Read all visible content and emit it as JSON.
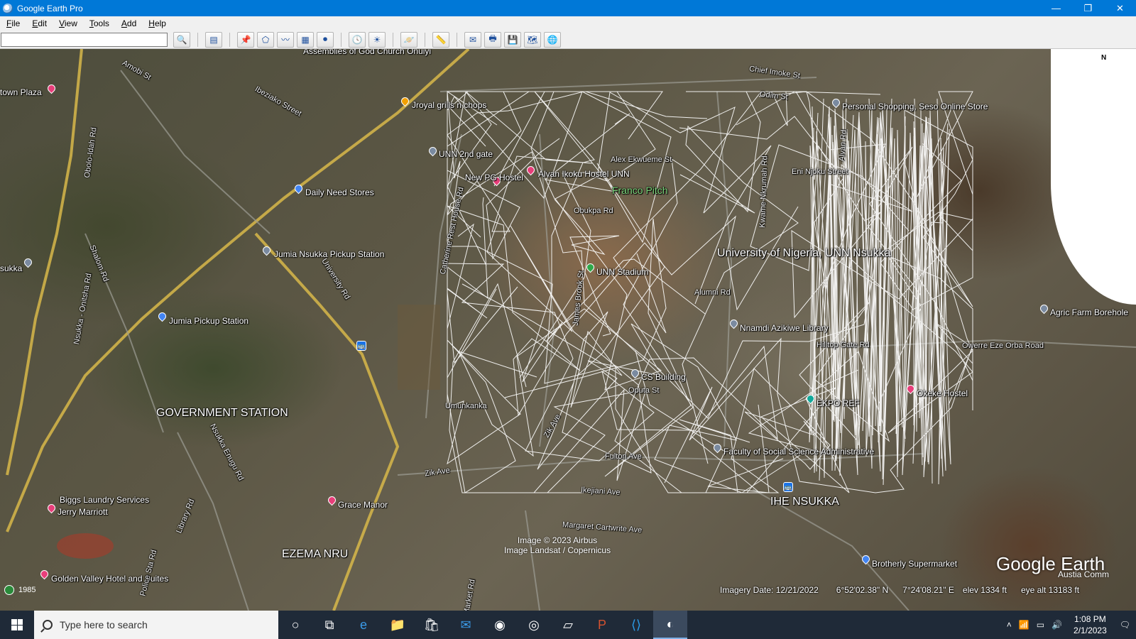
{
  "window": {
    "title": "Google Earth Pro",
    "minimize": "—",
    "restore": "❐",
    "close": "✕"
  },
  "menu": [
    "File",
    "Edit",
    "View",
    "Tools",
    "Add",
    "Help"
  ],
  "toolbar": {
    "search_value": "",
    "search_icon": "search-icon",
    "buttons": [
      "sidebar-toggle-icon",
      "add-placemark-icon",
      "add-polygon-icon",
      "add-path-icon",
      "add-image-overlay-icon",
      "record-tour-icon",
      "historical-imagery-icon",
      "sunlight-icon",
      "switch-planet-icon",
      "ruler-icon",
      "email-icon",
      "print-icon",
      "save-image-icon",
      "view-maps-icon",
      "earth-icon"
    ]
  },
  "map": {
    "north_label": "N",
    "places": [
      {
        "name": "Assemblies of God Church Onuiyi",
        "pin": "none"
      },
      {
        "name": "Chief Imoke St",
        "pin": "none"
      },
      {
        "name": "Odim St",
        "pin": "none"
      },
      {
        "name": "town Plaza",
        "pin": "pink"
      },
      {
        "name": "Amobi St",
        "pin": "none"
      },
      {
        "name": "Ibeziako Street",
        "pin": "none"
      },
      {
        "name": "Jroyal grills n chops",
        "pin": "orange"
      },
      {
        "name": "Personal Shopping, Seso Online Store",
        "pin": "gray"
      },
      {
        "name": "UNN 2nd gate",
        "pin": "gray"
      },
      {
        "name": "Alvan Ikoku Hostel UNN",
        "pin": "pink"
      },
      {
        "name": "New PG Hostel",
        "pin": "pink"
      },
      {
        "name": "Alex Ekwueme St",
        "pin": "none"
      },
      {
        "name": "Eni Njoku Street",
        "pin": "none"
      },
      {
        "name": "Franco Pitch",
        "pin": "none"
      },
      {
        "name": "Daily Need Stores",
        "pin": "blue"
      },
      {
        "name": "Obukpa Rd",
        "pin": "none"
      },
      {
        "name": "University of Nigeria, UNN Nsukka",
        "pin": "none"
      },
      {
        "name": "Jumia Nsukka Pickup Station",
        "pin": "gray"
      },
      {
        "name": "UNN Stadium",
        "pin": "green"
      },
      {
        "name": "Alumni Rd",
        "pin": "none"
      },
      {
        "name": "Agric Farm Borehole",
        "pin": "gray"
      },
      {
        "name": "Jumia Pickup Station",
        "pin": "blue"
      },
      {
        "name": "Nnamdi Azikiwe Library",
        "pin": "gray"
      },
      {
        "name": "Hilltop Gate Rd",
        "pin": "none"
      },
      {
        "name": "Owerre Eze Orba Road",
        "pin": "none"
      },
      {
        "name": "CS Building",
        "pin": "gray"
      },
      {
        "name": "Oputa St",
        "pin": "none"
      },
      {
        "name": "Okeke Hostel",
        "pin": "pink"
      },
      {
        "name": "EKPO REF",
        "pin": "teal"
      },
      {
        "name": "GOVERNMENT STATION",
        "pin": "none"
      },
      {
        "name": "Umunkanka",
        "pin": "none"
      },
      {
        "name": "Faculty of Social Science Administrative",
        "pin": "gray"
      },
      {
        "name": "Fulton Ave",
        "pin": "none"
      },
      {
        "name": "Zik Ave",
        "pin": "none"
      },
      {
        "name": "Ikejiani Ave",
        "pin": "none"
      },
      {
        "name": "IHE NSUKKA",
        "pin": "none"
      },
      {
        "name": "Biggs Laundry Services",
        "pin": "none"
      },
      {
        "name": "Jerry Marriott",
        "pin": "pink"
      },
      {
        "name": "Grace Manor",
        "pin": "pink"
      },
      {
        "name": "Margaret Cartwrite Ave",
        "pin": "none"
      },
      {
        "name": "EZEMA NRU",
        "pin": "none"
      },
      {
        "name": "Brotherly Supermarket",
        "pin": "blue"
      },
      {
        "name": "Golden Valley Hotel and Suites",
        "pin": "pink"
      },
      {
        "name": "Obolo-Idah Rd",
        "pin": "none"
      },
      {
        "name": "Nsukka - Onitsha Rd",
        "pin": "none"
      },
      {
        "name": "Shalom Rd",
        "pin": "none"
      },
      {
        "name": "University Rd",
        "pin": "none"
      },
      {
        "name": "Catherine Rest House Rd",
        "pin": "none"
      },
      {
        "name": "Kwame Nkrumah Rd",
        "pin": "none"
      },
      {
        "name": "Alvan Rd",
        "pin": "none"
      },
      {
        "name": "James Brook St",
        "pin": "none"
      },
      {
        "name": "Zik Ave",
        "pin": "none"
      },
      {
        "name": "Library Rd",
        "pin": "none"
      },
      {
        "name": "Nsukka Enugu Rd",
        "pin": "none"
      },
      {
        "name": "Police Sta Rd",
        "pin": "none"
      },
      {
        "name": "Market Rd",
        "pin": "none"
      },
      {
        "name": "sukka",
        "pin": "gray"
      }
    ],
    "credits": [
      "Image © 2023 Airbus",
      "Image Landsat / Copernicus"
    ],
    "logo": "Google Earth",
    "logo_sub": "Austia Comm",
    "historical_year": "1985",
    "status": {
      "imagery_date": "Imagery Date: 12/21/2022",
      "lat": "6°52'02.38\" N",
      "lon": "7°24'08.21\" E",
      "elev": "elev  1334 ft",
      "eye_alt": "eye alt  13183 ft"
    }
  },
  "taskbar": {
    "search_placeholder": "Type here to search",
    "apps": [
      "cortana-icon",
      "task-view-icon",
      "edge-icon",
      "file-explorer-icon",
      "store-icon",
      "mail-icon",
      "chrome-icon",
      "chrome-profile-icon",
      "notepad-icon",
      "powerpoint-icon",
      "vscode-icon",
      "google-earth-icon"
    ],
    "time": "1:08 PM",
    "date": "2/1/2023"
  }
}
